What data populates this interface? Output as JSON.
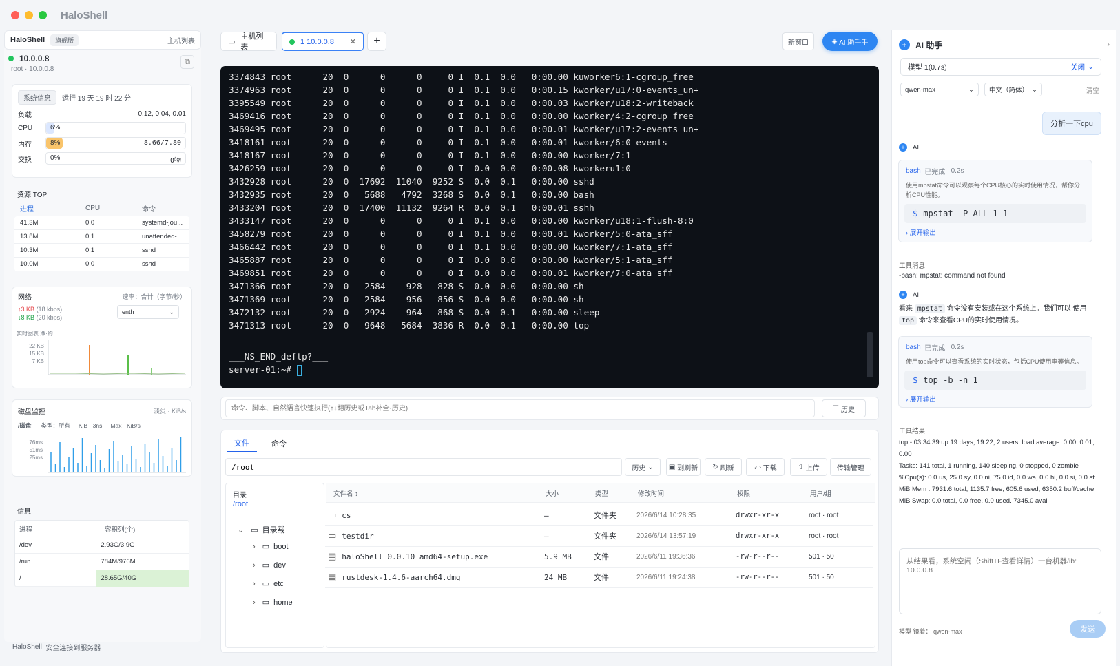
{
  "app": {
    "title": "HaloShell",
    "footer": "HaloShell",
    "footer_status": "安全连接到服务器"
  },
  "left": {
    "brand": "HaloShell",
    "badge": "旗舰版",
    "host_list": "主机列表",
    "host": {
      "ip": "10.0.0.8",
      "user": "root",
      "sep": "·",
      "addr": "10.0.0.8",
      "status_color": "#22c55e"
    },
    "sysinfo": {
      "tab": "系统信息",
      "uptime": "运行 19 天 19 时 22 分",
      "load_label": "负载",
      "load_value": "0.12, 0.04, 0.01",
      "cpu_label": "CPU",
      "cpu_value": "6%",
      "cpu_pct": 6,
      "mem_label": "内存",
      "mem_value": "8%",
      "mem_detail": "8.66/7.80",
      "mem_pct": 8,
      "swap_label": "交换",
      "swap_value": "0%",
      "swap_detail": "0物",
      "swap_pct": 0
    },
    "top": {
      "title": "资源 TOP",
      "headers": [
        "进程",
        "CPU",
        "命令"
      ],
      "rows": [
        [
          "41.3M",
          "0.0",
          "systemd-jou..."
        ],
        [
          "13.8M",
          "0.1",
          "unattended-..."
        ],
        [
          "10.3M",
          "0.1",
          "sshd"
        ],
        [
          "10.0M",
          "0.0",
          "sshd"
        ]
      ]
    },
    "net": {
      "title": "网络",
      "rate_label": "速率：合计（字节/秒）",
      "up": "↑3",
      "up_val": "KB",
      "up_rate": "(18 kbps)",
      "down": "↓8",
      "down_val": "KB",
      "down_rate": "(20 kbps)",
      "iface": "enth",
      "graph_label": "实时图表 净·约",
      "y": [
        "22 KB",
        "15 KB",
        "7 KB"
      ]
    },
    "disk": {
      "title": "磁盘监控",
      "right": "淡炎 · KiB/s",
      "tab": "/磁盘",
      "f1": "类型：所有",
      "f2": "KiB · 3ns",
      "f3": "Max · KiB/s",
      "y": [
        "76ms",
        "51ms",
        "25ms"
      ]
    },
    "info": {
      "title": "信息",
      "headers": [
        "进程",
        "容积列(个)"
      ],
      "rows": [
        [
          "/dev",
          "2.93G/3.9G"
        ],
        [
          "/run",
          "784M/976M"
        ],
        [
          "/",
          "28.65G/40G"
        ]
      ]
    }
  },
  "tabs": {
    "hosts": "主机列表",
    "current": "1 10.0.0.8",
    "new_window": "新窗口",
    "ai": "AI 助手手"
  },
  "terminal": {
    "lines": [
      "3374843 root      20  0      0      0     0 I  0.1  0.0   0:00.00 kuworker6:1-cgroup_free",
      "3374963 root      20  0      0      0     0 I  0.1  0.0   0:00.15 kworker/u17:0-events_un+",
      "3395549 root      20  0      0      0     0 I  0.1  0.0   0:00.03 kworker/u18:2-writeback",
      "3469416 root      20  0      0      0     0 I  0.1  0.0   0:00.00 kworker/4:2-cgroup_free",
      "3469495 root      20  0      0      0     0 I  0.1  0.0   0:00.01 kworker/u17:2-events_un+",
      "3418161 root      20  0      0      0     0 I  0.1  0.0   0:00.01 kworker/6:0-events",
      "3418167 root      20  0      0      0     0 I  0.1  0.0   0:00.00 kworker/7:1",
      "3426259 root      20  0      0      0     0 I  0.0  0.0   0:00.08 kworkeru1:0",
      "3432928 root      20  0  17692  11040  9252 S  0.0  0.1   0:00.00 sshd",
      "3432935 root      20  0   5688   4792  3268 S  0.0  0.1   0:00.00 bash",
      "3433204 root      20  0  17400  11132  9264 R  0.0  0.1   0:00.01 sshh",
      "3433147 root      20  0      0      0     0 I  0.1  0.0   0:00.00 kworker/u18:1-flush-8:0",
      "3458279 root      20  0      0      0     0 I  0.1  0.0   0:00.01 kworker/5:0-ata_sff",
      "3466442 root      20  0      0      0     0 I  0.1  0.0   0:00.00 kworker/7:1-ata_sff",
      "3465887 root      20  0      0      0     0 I  0.0  0.0   0:00.00 kworker/5:1-ata_sff",
      "3469851 root      20  0      0      0     0 I  0.0  0.0   0:00.01 kworker/7:0-ata_sff",
      "3471366 root      20  0   2584    928   828 S  0.0  0.0   0:00.00 sh",
      "3471369 root      20  0   2584    956   856 S  0.0  0.0   0:00.00 sh",
      "3472132 root      20  0   2924    964   868 S  0.0  0.1   0:00.00 sleep",
      "3471313 root      20  0   9648   5684  3836 R  0.0  0.1   0:00.00 top"
    ],
    "marker": "___NS_END_deftp?___",
    "prompt": "server-01:~# "
  },
  "cmdbar": {
    "placeholder": "命令、脚本、自然语言快速执行(↑↓翻历史或Tab补全·历史)",
    "history": "历史"
  },
  "files": {
    "tab_files": "文件",
    "tab_cmd": "命令",
    "path": "/root",
    "buttons": [
      "历史",
      "副刷新",
      "刷新",
      "下载",
      "上传",
      "传输管理"
    ],
    "dir_label": "目录",
    "dir_path": "/root",
    "root_node": "目录载",
    "tree": [
      "boot",
      "dev",
      "etc",
      "home"
    ],
    "headers": [
      "文件名 ↕",
      "大小",
      "类型",
      "修改时间",
      "权限",
      "用户/组"
    ],
    "rows": [
      [
        "cs",
        "–",
        "文件夹",
        "2026/6/14 10:28:35",
        "drwxr-xr-x",
        "root · root"
      ],
      [
        "testdir",
        "–",
        "文件夹",
        "2026/6/14 13:57:19",
        "drwxr-xr-x",
        "root · root"
      ],
      [
        "haloShell_0.0.10_amd64-setup.exe",
        "5.9 MB",
        "文件",
        "2026/6/11 19:36:36",
        "-rw-r--r--",
        "501 · 50"
      ],
      [
        "rustdesk-1.4.6-aarch64.dmg",
        "24 MB",
        "文件",
        "2026/6/11 19:24:38",
        "-rw-r--r--",
        "501 · 50"
      ]
    ]
  },
  "ai": {
    "title": "AI 助手",
    "model_status": "模型 1(0.7s)",
    "close": "关闭",
    "model": "qwen-max",
    "lang": "中文（简体）",
    "clear": "清空",
    "user_msg": "分析一下cpu",
    "ai_label": "AI",
    "tool1": {
      "name": "bash",
      "status": "已完成",
      "time": "0.2s",
      "desc": "使用mpstat命令可以观察每个CPU核心的实时使用情况，帮你分析CPU性能。",
      "cmd": "mpstat -P ALL 1 1",
      "expand": "展开输出"
    },
    "tool_msg_label": "工具消息",
    "tool_msg": "-bash: mpstat: command not found",
    "ai2_a": "看来",
    "ai2_code": "mpstat",
    "ai2_b": "命令没有安装或在这个系统上。我们可以 使用",
    "ai2_code2": "top",
    "ai2_c": "命令来查看CPU的实时使用情况。",
    "tool2": {
      "name": "bash",
      "status": "已完成",
      "time": "0.2s",
      "desc": "使用top命令可以查看系统的实时状态，包括CPU使用率等信息。",
      "cmd": "top -b -n 1",
      "expand": "展开输出"
    },
    "result_label": "工具结果",
    "result": [
      "top - 03:34:39 up 19 days, 19:22,  2 users,  load average: 0.00, 0.01, 0.00",
      "Tasks: 141 total,   1 running, 140 sleeping,   0 stopped,   0 zombie",
      "%Cpu(s):  0.0 us, 25.0 sy, 0.0 ni, 75.0 id,  0.0 wa,  0.0 hi, 0.0 si, 0.0 st",
      "MiB Mem :   7931.6 total,   1135.7 free,    605.6 used,   6350.2 buff/cache",
      "MiB Swap:      0.0 total,      0.0 free,      0.0 used.   7345.0 avail"
    ],
    "input_placeholder": "从结果看，系统空闲（Shift+F查看详情）一台机器/ib: 10.0.0.8",
    "footer_model": "模型 镜着：  qwen-max",
    "send": "发送"
  }
}
